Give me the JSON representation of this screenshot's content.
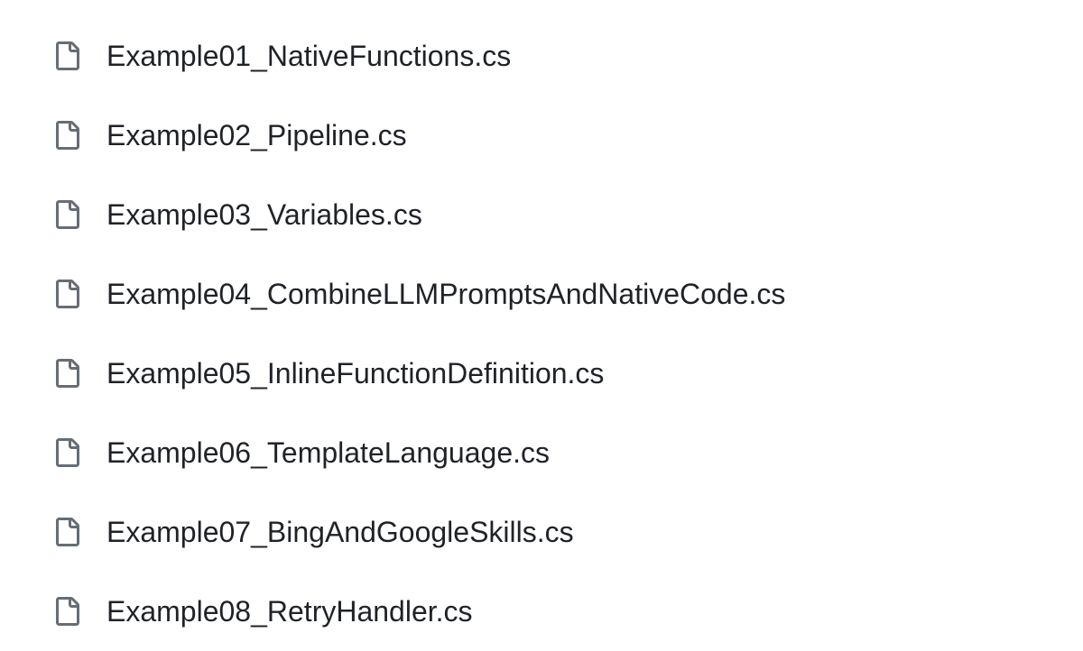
{
  "files": [
    {
      "name": "Example01_NativeFunctions.cs"
    },
    {
      "name": "Example02_Pipeline.cs"
    },
    {
      "name": "Example03_Variables.cs"
    },
    {
      "name": "Example04_CombineLLMPromptsAndNativeCode.cs"
    },
    {
      "name": "Example05_InlineFunctionDefinition.cs"
    },
    {
      "name": "Example06_TemplateLanguage.cs"
    },
    {
      "name": "Example07_BingAndGoogleSkills.cs"
    },
    {
      "name": "Example08_RetryHandler.cs"
    }
  ]
}
